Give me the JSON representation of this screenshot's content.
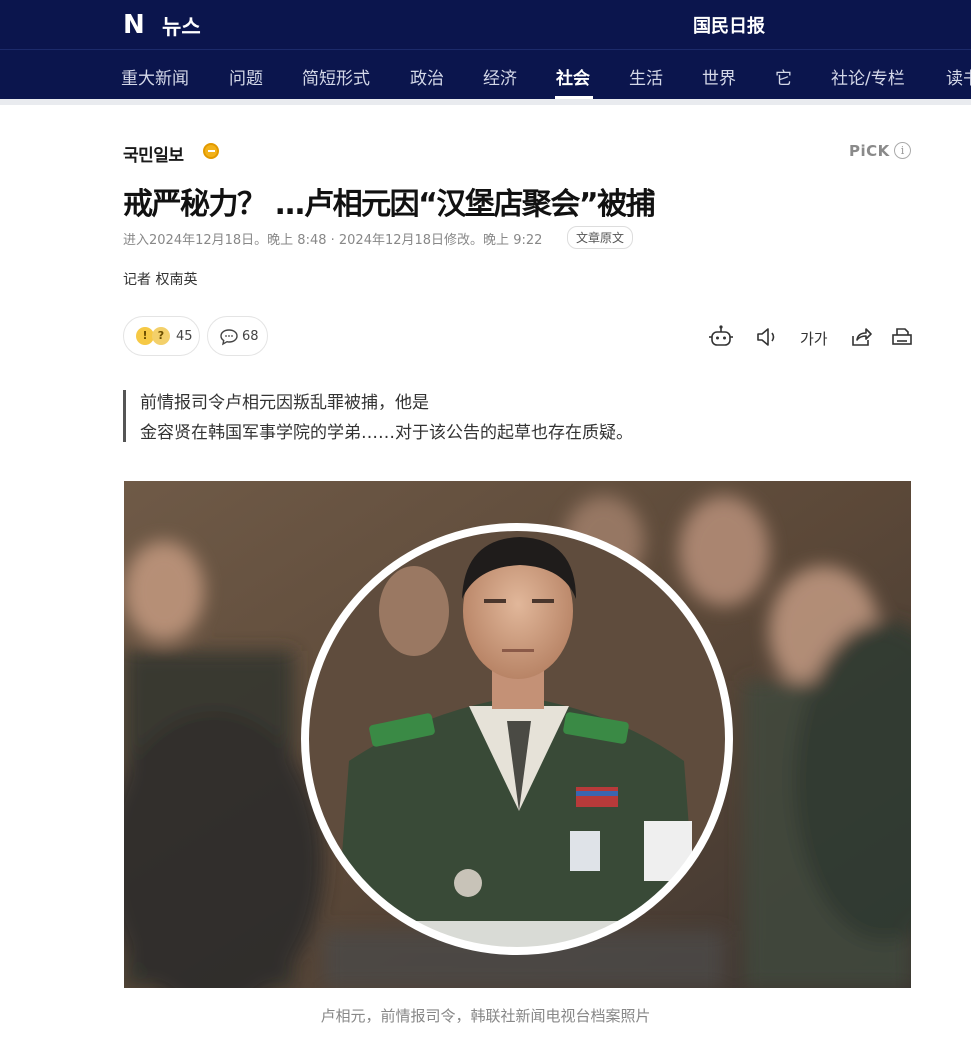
{
  "header": {
    "logo_n": "N",
    "logo_news": "뉴스",
    "press_name": "国民日报"
  },
  "nav": {
    "items": [
      {
        "label": "重大新闻",
        "active": false
      },
      {
        "label": "问题",
        "active": false
      },
      {
        "label": "简短形式",
        "active": false
      },
      {
        "label": "政治",
        "active": false
      },
      {
        "label": "经济",
        "active": false
      },
      {
        "label": "社会",
        "active": true
      },
      {
        "label": "生活",
        "active": false
      },
      {
        "label": "世界",
        "active": false
      },
      {
        "label": "它",
        "active": false
      },
      {
        "label": "社论/专栏",
        "active": false
      },
      {
        "label": "读书",
        "active": false
      }
    ]
  },
  "article": {
    "press_logo": "국민일보",
    "pick_label": "PiCK",
    "pick_info": "i",
    "headline": "戒严秘力？ ...卢相元因“汉堡店聚会”被捕",
    "dateline": "进入2024年12月18日。晚上 8:48 · 2024年12月18日修改。晚上 9:22",
    "original_link": "文章原文",
    "reporter": "记者 权南英",
    "reactions": {
      "count": "45"
    },
    "comments": {
      "count": "68"
    },
    "tools": {
      "font_size_label": "가가"
    },
    "summary": [
      "前情报司令卢相元因叛乱罪被捕，他是",
      "金容贤在韩国军事学院的学弟……对于该公告的起草也存在质疑。"
    ],
    "photo_caption": "卢相元，前情报司令，韩联社新闻电视台档案照片"
  },
  "colors": {
    "header_bg": "#0b154d",
    "press_dot": "#f2b21b"
  }
}
